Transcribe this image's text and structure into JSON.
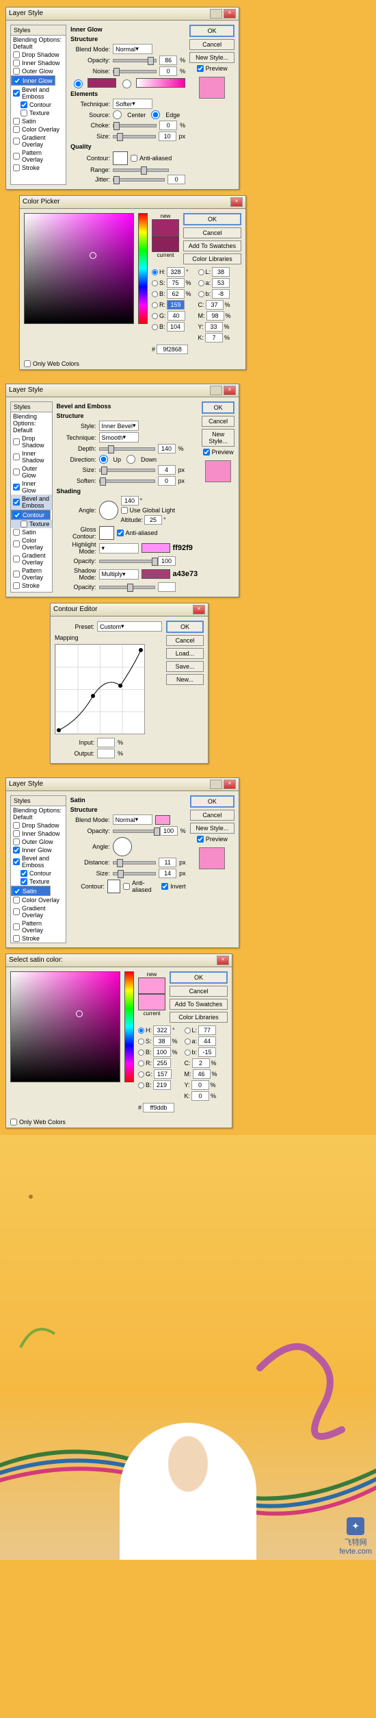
{
  "panel1": {
    "title": "Layer Style",
    "styles_header": "Styles",
    "blend_opts": "Blending Options: Default",
    "list": [
      "Drop Shadow",
      "Inner Shadow",
      "Outer Glow",
      "Inner Glow",
      "Bevel and Emboss",
      "Contour",
      "Texture",
      "Satin",
      "Color Overlay",
      "Gradient Overlay",
      "Pattern Overlay",
      "Stroke"
    ],
    "checked": {
      "Inner Glow": true,
      "Bevel and Emboss": true,
      "Contour": true
    },
    "selected": "Inner Glow",
    "center": {
      "title": "Inner Glow",
      "structure": "Structure",
      "blend_mode_l": "Blend Mode:",
      "blend_mode_v": "Normal",
      "opacity_l": "Opacity:",
      "opacity_v": "86",
      "pct": "%",
      "noise_l": "Noise:",
      "noise_v": "0",
      "elements": "Elements",
      "technique_l": "Technique:",
      "technique_v": "Softer",
      "source_l": "Source:",
      "center_r": "Center",
      "edge_r": "Edge",
      "choke_l": "Choke:",
      "choke_v": "0",
      "size_l": "Size:",
      "size_v": "10",
      "px": "px",
      "quality": "Quality",
      "contour_l": "Contour:",
      "aa": "Anti-aliased",
      "range_l": "Range:",
      "jitter_l": "Jitter:",
      "jitter_v": "0"
    },
    "btns": {
      "ok": "OK",
      "cancel": "Cancel",
      "newstyle": "New Style...",
      "preview": "Preview"
    }
  },
  "picker1": {
    "title": "Color Picker",
    "new_l": "new",
    "current_l": "current",
    "hsb": {
      "H": "328",
      "S": "75",
      "B": "62"
    },
    "rgb": {
      "R": "159",
      "G": "40",
      "B": "104"
    },
    "lab": {
      "L": "38",
      "a": "53",
      "b": "-8"
    },
    "cmyk": {
      "C": "37",
      "M": "98",
      "Y": "33",
      "K": "7"
    },
    "hex_l": "#",
    "hex": "9f2868",
    "web": "Only Web Colors",
    "btns": {
      "ok": "OK",
      "cancel": "Cancel",
      "add": "Add To Swatches",
      "lib": "Color Libraries"
    },
    "new_color": "#9f2868",
    "cur_color": "#8c2058"
  },
  "panel2": {
    "title": "Layer Style",
    "selected": "Contour",
    "center": {
      "title": "Bevel and Emboss",
      "structure": "Structure",
      "style_l": "Style:",
      "style_v": "Inner Bevel",
      "tech_l": "Technique:",
      "tech_v": "Smooth",
      "depth_l": "Depth:",
      "depth_v": "140",
      "pct": "%",
      "dir_l": "Direction:",
      "up": "Up",
      "down": "Down",
      "size_l": "Size:",
      "size_v": "4",
      "px": "px",
      "soften_l": "Soften:",
      "soften_v": "0",
      "shading": "Shading",
      "angle_l": "Angle:",
      "angle_v": "140",
      "ugl": "Use Global Light",
      "alt_l": "Altitude:",
      "alt_v": "25",
      "gloss_l": "Gloss Contour:",
      "aa": "Anti-aliased",
      "hl_l": "Highlight Mode:",
      "hl_main": "",
      "hl_color": "ff92f9",
      "hl_o": "100",
      "sh_l": "Shadow Mode:",
      "sh_v": "Multiply",
      "sh_color": "a43e73",
      "sh_o": "",
      "op_l": "Opacity:"
    }
  },
  "contour_editor": {
    "title": "Contour Editor",
    "preset_l": "Preset:",
    "preset_v": "Custom",
    "mapping": "Mapping",
    "input_l": "Input:",
    "output_l": "Output:",
    "pct": "%",
    "btns": {
      "ok": "OK",
      "cancel": "Cancel",
      "load": "Load...",
      "save": "Save...",
      "new": "New..."
    }
  },
  "panel3": {
    "title": "Layer Style",
    "selected": "Satin",
    "checked": {
      "Inner Glow": true,
      "Bevel and Emboss": true,
      "Contour": true,
      "Texture": true,
      "Satin": true
    },
    "center": {
      "title": "Satin",
      "structure": "Structure",
      "blend_l": "Blend Mode:",
      "blend_v": "Normal",
      "opacity_l": "Opacity:",
      "opacity_v": "100",
      "pct": "%",
      "angle_l": "Angle:",
      "dist_l": "Distance:",
      "dist_v": "11",
      "px": "px",
      "size_l": "Size:",
      "size_v": "14",
      "contour_l": "Contour:",
      "aa": "Anti-aliased",
      "invert": "Invert"
    }
  },
  "picker2": {
    "title": "Select satin color:",
    "new_l": "new",
    "current_l": "current",
    "hsb": {
      "H": "322",
      "S": "38",
      "B": "100"
    },
    "rgb": {
      "R": "255",
      "G": "157",
      "B": "219"
    },
    "lab": {
      "L": "77",
      "a": "44",
      "b": "-15"
    },
    "cmyk": {
      "C": "2",
      "M": "46",
      "Y": "0",
      "K": "0"
    },
    "hex_l": "#",
    "hex": "ff9ddb",
    "web": "Only Web Colors",
    "new_color": "#ff9ddb",
    "cur_color": "#ff9ddb"
  },
  "watermark": {
    "line1": "飞特网",
    "line2": "fevte.com"
  }
}
